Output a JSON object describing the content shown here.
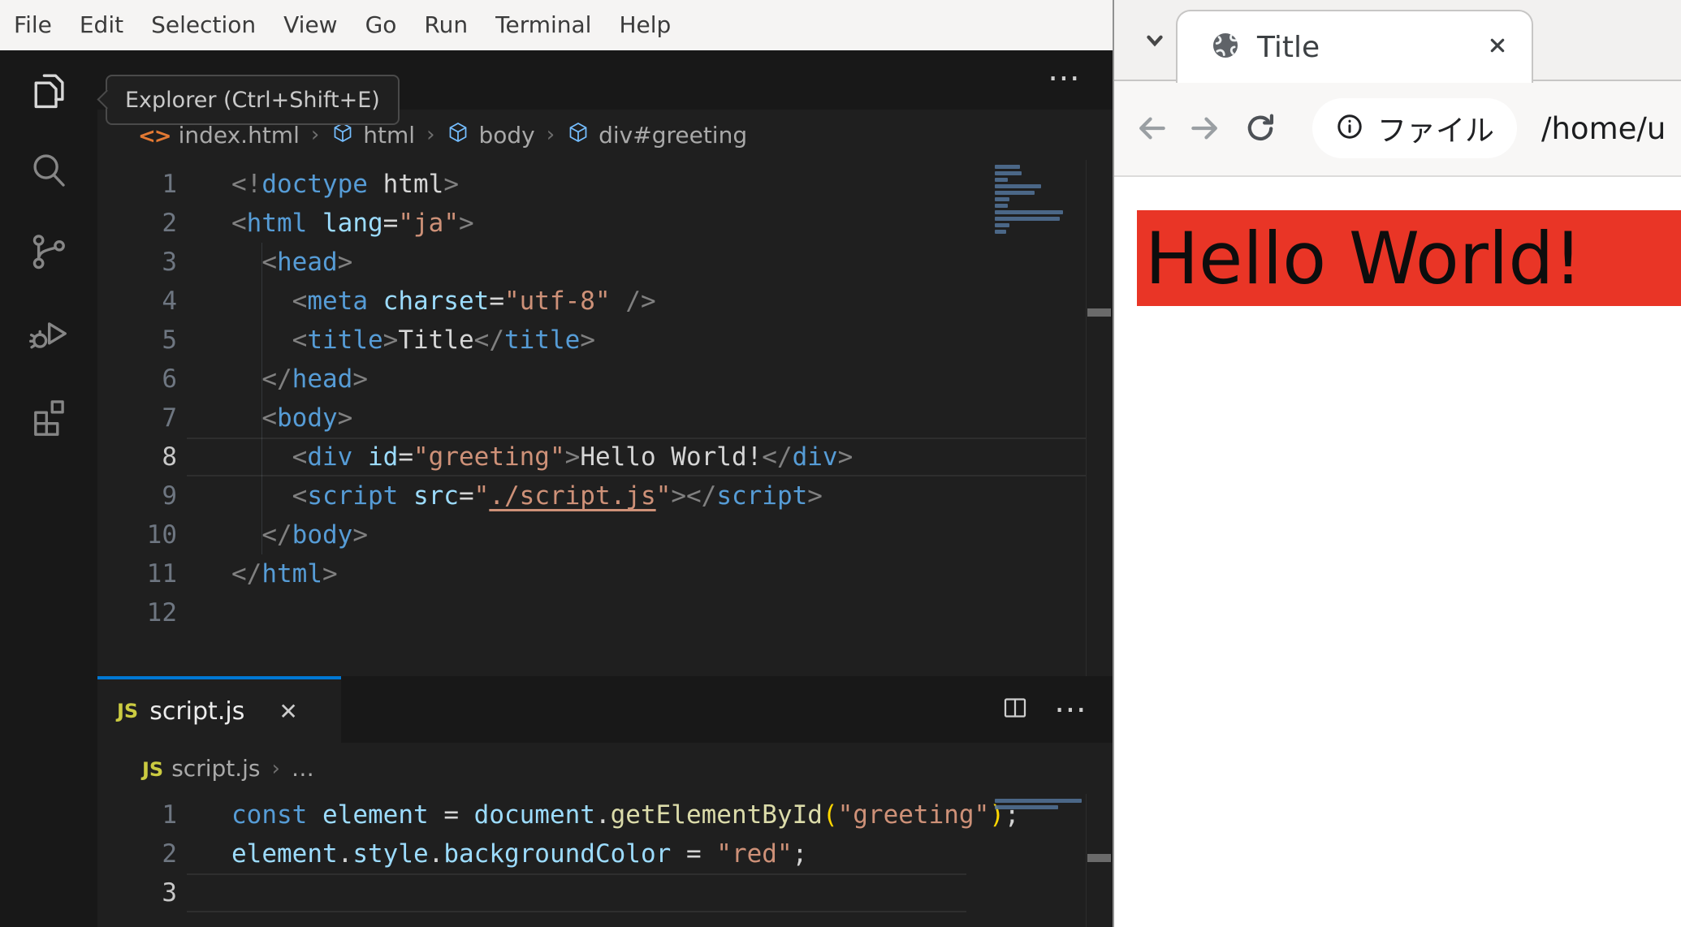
{
  "vscode": {
    "menubar": {
      "items": [
        "File",
        "Edit",
        "Selection",
        "View",
        "Go",
        "Run",
        "Terminal",
        "Help"
      ]
    },
    "activity_bar": {
      "items": [
        {
          "name": "explorer-icon",
          "active": true
        },
        {
          "name": "search-icon",
          "active": false
        },
        {
          "name": "source-control-icon",
          "active": false
        },
        {
          "name": "run-debug-icon",
          "active": false
        },
        {
          "name": "extensions-icon",
          "active": false
        }
      ]
    },
    "tooltip": {
      "text": "Explorer (Ctrl+Shift+E)"
    },
    "group1": {
      "actions": {
        "more": "⋯"
      },
      "breadcrumbs": [
        {
          "icon": "html-file-icon",
          "label": "index.html"
        },
        {
          "icon": "symbol-cube-icon",
          "label": "html"
        },
        {
          "icon": "symbol-cube-icon",
          "label": "body"
        },
        {
          "icon": "symbol-cube-icon",
          "label": "div#greeting"
        }
      ],
      "active_line": 8,
      "lines": [
        [
          [
            "pu",
            "<!"
          ],
          [
            "kw",
            "doctype"
          ],
          [
            "tx",
            " html"
          ],
          [
            "pu",
            ">"
          ]
        ],
        [
          [
            "pu",
            "<"
          ],
          [
            "tg",
            "html"
          ],
          [
            "tx",
            " "
          ],
          [
            "at",
            "lang"
          ],
          [
            "op",
            "="
          ],
          [
            "st",
            "\"ja\""
          ],
          [
            "pu",
            ">"
          ]
        ],
        [
          [
            "tx",
            "  "
          ],
          [
            "pu",
            "<"
          ],
          [
            "tg",
            "head"
          ],
          [
            "pu",
            ">"
          ]
        ],
        [
          [
            "tx",
            "    "
          ],
          [
            "pu",
            "<"
          ],
          [
            "tg",
            "meta"
          ],
          [
            "tx",
            " "
          ],
          [
            "at",
            "charset"
          ],
          [
            "op",
            "="
          ],
          [
            "st",
            "\"utf-8\""
          ],
          [
            "tx",
            " "
          ],
          [
            "pu",
            "/>"
          ]
        ],
        [
          [
            "tx",
            "    "
          ],
          [
            "pu",
            "<"
          ],
          [
            "tg",
            "title"
          ],
          [
            "pu",
            ">"
          ],
          [
            "tx",
            "Title"
          ],
          [
            "pu",
            "</"
          ],
          [
            "tg",
            "title"
          ],
          [
            "pu",
            ">"
          ]
        ],
        [
          [
            "tx",
            "  "
          ],
          [
            "pu",
            "</"
          ],
          [
            "tg",
            "head"
          ],
          [
            "pu",
            ">"
          ]
        ],
        [
          [
            "tx",
            "  "
          ],
          [
            "pu",
            "<"
          ],
          [
            "tg",
            "body"
          ],
          [
            "pu",
            ">"
          ]
        ],
        [
          [
            "tx",
            "    "
          ],
          [
            "pu",
            "<"
          ],
          [
            "tg",
            "div"
          ],
          [
            "tx",
            " "
          ],
          [
            "at",
            "id"
          ],
          [
            "op",
            "="
          ],
          [
            "st",
            "\"greeting\""
          ],
          [
            "pu",
            ">"
          ],
          [
            "tx",
            "Hello World!"
          ],
          [
            "pu",
            "</"
          ],
          [
            "tg",
            "div"
          ],
          [
            "pu",
            ">"
          ]
        ],
        [
          [
            "tx",
            "    "
          ],
          [
            "pu",
            "<"
          ],
          [
            "tg",
            "script"
          ],
          [
            "tx",
            " "
          ],
          [
            "at",
            "src"
          ],
          [
            "op",
            "="
          ],
          [
            "st",
            "\""
          ],
          [
            "ln",
            "./script.js"
          ],
          [
            "st",
            "\""
          ],
          [
            "pu",
            "></"
          ],
          [
            "tg",
            "script"
          ],
          [
            "pu",
            ">"
          ]
        ],
        [
          [
            "tx",
            "  "
          ],
          [
            "pu",
            "</"
          ],
          [
            "tg",
            "body"
          ],
          [
            "pu",
            ">"
          ]
        ],
        [
          [
            "pu",
            "</"
          ],
          [
            "tg",
            "html"
          ],
          [
            "pu",
            ">"
          ]
        ],
        []
      ]
    },
    "group2": {
      "tab": {
        "icon": "js-file-icon",
        "label": "script.js",
        "close": "✕"
      },
      "actions": {
        "split": "split-editor-icon",
        "more": "⋯"
      },
      "breadcrumbs": [
        {
          "icon": "js-file-icon",
          "label": "script.js"
        },
        {
          "icon": null,
          "label": "…"
        }
      ],
      "active_line": 3,
      "lines": [
        [
          [
            "kw",
            "const"
          ],
          [
            "tx",
            " "
          ],
          [
            "vr",
            "element"
          ],
          [
            "op",
            " = "
          ],
          [
            "vr",
            "document"
          ],
          [
            "op",
            "."
          ],
          [
            "fn",
            "getElementById"
          ],
          [
            "bk",
            "("
          ],
          [
            "st",
            "\"greeting\""
          ],
          [
            "bk",
            ")"
          ],
          [
            "op",
            ";"
          ]
        ],
        [
          [
            "vr",
            "element"
          ],
          [
            "op",
            "."
          ],
          [
            "vr",
            "style"
          ],
          [
            "op",
            "."
          ],
          [
            "vr",
            "backgroundColor"
          ],
          [
            "op",
            " = "
          ],
          [
            "st",
            "\"red\""
          ],
          [
            "op",
            ";"
          ]
        ],
        []
      ]
    },
    "colors": {
      "accent_blue": "#0078d4",
      "js_yellow": "#cbcb41",
      "html_orange": "#e37933",
      "symbol_blue": "#75beff"
    }
  },
  "browser": {
    "tab": {
      "icon": "globe-icon",
      "title": "Title",
      "close": "✕"
    },
    "navbar": {
      "back": "back-arrow-icon",
      "forward": "forward-arrow-icon",
      "reload": "reload-icon",
      "chip_icon": "info-icon",
      "chip_label": "ファイル",
      "url": "/home/u"
    },
    "page": {
      "text": "Hello World!",
      "banner_color": "#e93526",
      "text_color": "#0d0d0d"
    }
  }
}
